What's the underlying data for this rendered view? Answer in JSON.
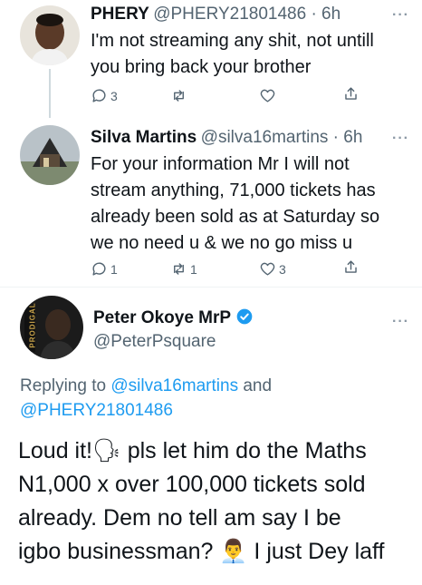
{
  "tweets": [
    {
      "display_name": "PHERY",
      "handle_time": "@PHERY21801486 · 6h",
      "more": "···",
      "text_lines": [
        "I'm not streaming any shit, not untill",
        "you bring back your brother"
      ],
      "reply_count": "3",
      "retweet_count": "",
      "like_count": ""
    },
    {
      "display_name": "Silva Martins",
      "handle_time": "@silva16martins · 6h",
      "more": "···",
      "text_lines": [
        "For your information Mr I will not",
        "stream anything, 71,000 tickets has",
        "already been sold as at Saturday so",
        "we no need u & we no go miss u"
      ],
      "reply_count": "1",
      "retweet_count": "1",
      "like_count": "3"
    }
  ],
  "main_tweet": {
    "display_name": "Peter Okoye MrP",
    "handle": "@PeterPsquare",
    "more": "···",
    "replying_prefix": "Replying to ",
    "replying_user1": "@silva16martins",
    "replying_and": " and",
    "replying_user2": "@PHERY21801486",
    "text_lines": [
      "Loud it!🗣 pls let him do the Maths",
      "N1,000 x over 100,000 tickets sold",
      "already. Dem no tell am say I be",
      "igbo businessman? 👨‍💼 I just Dey laff"
    ],
    "avatar_label": "PRODIGAL"
  },
  "colors": {
    "link": "#1d9bf0",
    "muted": "#536471",
    "verified": "#1d9bf0"
  }
}
